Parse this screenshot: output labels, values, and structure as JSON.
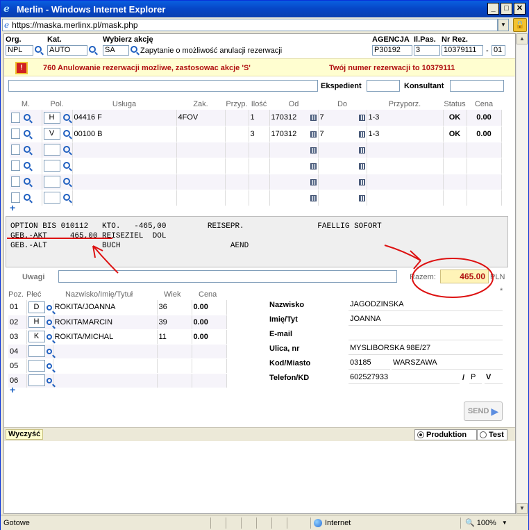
{
  "window": {
    "title": "Merlin - Windows Internet Explorer",
    "url": "https://maska.merlinx.pl/mask.php"
  },
  "header": {
    "org_label": "Org.",
    "org_value": "NPL",
    "kat_label": "Kat.",
    "kat_value": "AUTO",
    "akcja_label": "Wybierz akcję",
    "akcja_value": "SA",
    "akcja_desc": "Zapytanie o możliwość anulacji rezerwacji",
    "agencja_label": "AGENCJA",
    "agencja_value": "P30192",
    "ilpas_label": "Il.Pas.",
    "ilpas_value": "3",
    "nrrez_label": "Nr Rez.",
    "nrrez_value": "10379111",
    "nrrez_sep": "-",
    "nrrez_suffix": "01"
  },
  "message": {
    "left": "760 Anulowanie rezerwacji mozliwe, zastosowac akcje 'S'",
    "right": "Twój numer rezerwacji to 10379111"
  },
  "row2": {
    "ekspedient_label": "Ekspedient",
    "konsultant_label": "Konsultant"
  },
  "services": {
    "headers": [
      "M.",
      "Pol.",
      "Usługa",
      "Zak.",
      "Przyp.",
      "Ilość",
      "Od",
      "Do",
      "Przyporz.",
      "Status",
      "Cena"
    ],
    "rows": [
      {
        "pol": "H",
        "usluga": "04416 F",
        "zak": "4FOV",
        "przyp": "",
        "ilosc": "1",
        "od": "170312",
        "do": "7",
        "przyporz": "1-3",
        "status": "OK",
        "cena": "0.00"
      },
      {
        "pol": "V",
        "usluga": "00100 B",
        "zak": "",
        "przyp": "",
        "ilosc": "3",
        "od": "170312",
        "do": "7",
        "przyporz": "1-3",
        "status": "OK",
        "cena": "0.00"
      },
      {
        "pol": "",
        "usluga": "",
        "zak": "",
        "przyp": "",
        "ilosc": "",
        "od": "",
        "do": "",
        "przyporz": "",
        "status": "",
        "cena": ""
      },
      {
        "pol": "",
        "usluga": "",
        "zak": "",
        "przyp": "",
        "ilosc": "",
        "od": "",
        "do": "",
        "przyporz": "",
        "status": "",
        "cena": ""
      },
      {
        "pol": "",
        "usluga": "",
        "zak": "",
        "przyp": "",
        "ilosc": "",
        "od": "",
        "do": "",
        "przyporz": "",
        "status": "",
        "cena": ""
      },
      {
        "pol": "",
        "usluga": "",
        "zak": "",
        "przyp": "",
        "ilosc": "",
        "od": "",
        "do": "",
        "przyporz": "",
        "status": "",
        "cena": ""
      }
    ]
  },
  "terminal": {
    "line1": "OPTION BIS 010112   KTO.   -465,00         REISEPR.                FAELLIG SOFORT",
    "line2": "GEB.-AKT     465,00 REISEZIEL  DOL",
    "line3": "GEB.-ALT            BUCH                        AEND"
  },
  "uwagi": {
    "label": "Uwagi",
    "razem_label": "Razem:",
    "razem_value": "465.00",
    "currency": "PLN",
    "asterisk": "*"
  },
  "passengers": {
    "headers": [
      "Poz.",
      "Płeć",
      "Nazwisko/Imię/Tytuł",
      "Wiek",
      "Cena"
    ],
    "rows": [
      {
        "poz": "01",
        "plec": "D",
        "nazwisko": "ROKITA/JOANNA",
        "wiek": "36",
        "cena": "0.00"
      },
      {
        "poz": "02",
        "plec": "H",
        "nazwisko": "ROKITAMARCIN",
        "wiek": "39",
        "cena": "0.00"
      },
      {
        "poz": "03",
        "plec": "K",
        "nazwisko": "ROKITA/MICHAL",
        "wiek": "11",
        "cena": "0.00"
      },
      {
        "poz": "04",
        "plec": "",
        "nazwisko": "",
        "wiek": "",
        "cena": ""
      },
      {
        "poz": "05",
        "plec": "",
        "nazwisko": "",
        "wiek": "",
        "cena": ""
      },
      {
        "poz": "06",
        "plec": "",
        "nazwisko": "",
        "wiek": "",
        "cena": ""
      }
    ]
  },
  "customer": {
    "nazwisko_label": "Nazwisko",
    "nazwisko": "JAGODZINSKA",
    "imie_label": "Imię/Tyt",
    "imie": "JOANNA",
    "email_label": "E-mail",
    "email": "",
    "ulica_label": "Ulica, nr",
    "ulica": "MYSLIBORSKA 98E/27",
    "kod_label": "Kod/Miasto",
    "kod": "03185",
    "miasto": "WARSZAWA",
    "telefon_label": "Telefon/KD",
    "telefon": "602527933",
    "tel_sep": "/",
    "kd1": "P",
    "kd2": "V"
  },
  "actions": {
    "send_label": "SEND",
    "wyczysc_label": "Wyczyść",
    "produktion_label": "Produktion",
    "test_label": "Test"
  },
  "statusbar": {
    "text": "Gotowe",
    "zone": "Internet",
    "zoom": "100%"
  },
  "colors": {
    "accent_red": "#b01010",
    "annotation_red": "#dd1111",
    "title_blue": "#0a5fe0"
  }
}
